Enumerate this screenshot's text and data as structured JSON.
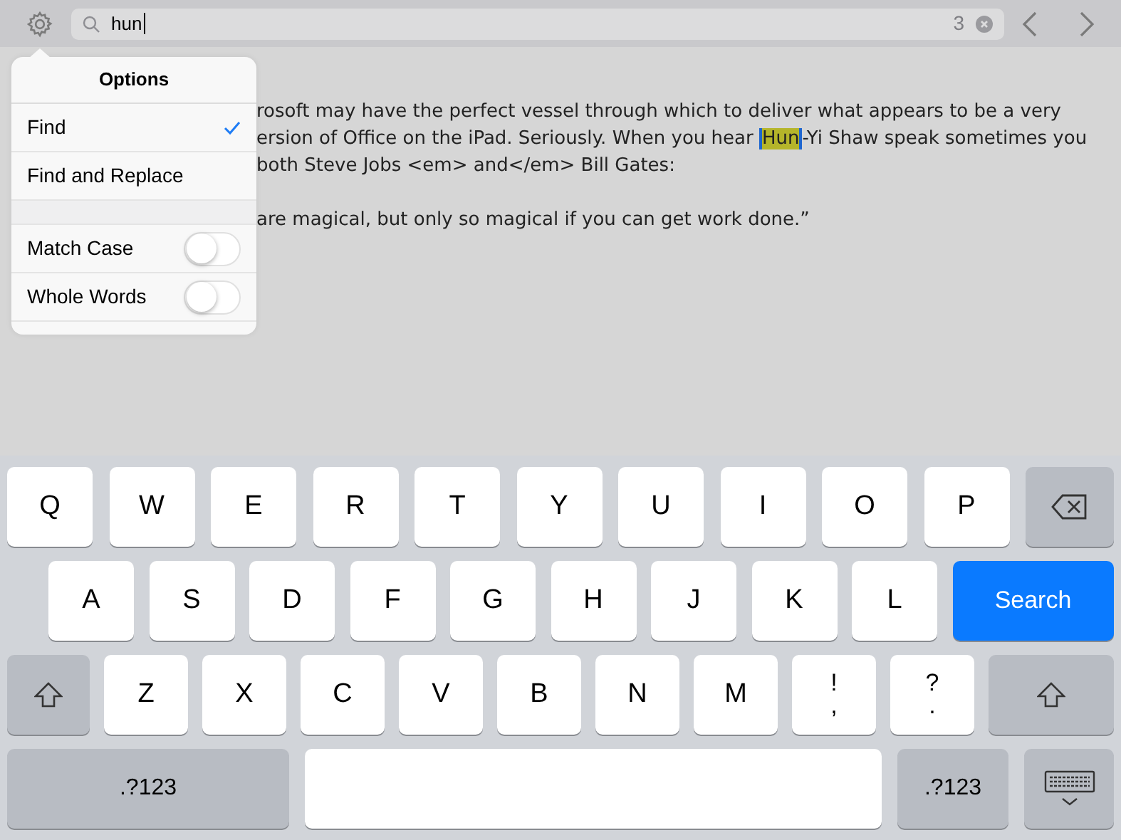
{
  "search": {
    "value": "hun",
    "count": "3"
  },
  "popover": {
    "title": "Options",
    "modes": [
      {
        "label": "Find",
        "selected": true
      },
      {
        "label": "Find and Replace",
        "selected": false
      }
    ],
    "toggles": [
      {
        "label": "Match Case",
        "on": false
      },
      {
        "label": "Whole Words",
        "on": false
      }
    ]
  },
  "document": {
    "paragraphs": [
      [
        {
          "text": "rosoft may have the perfect vessel through which to deliver what appears to be a very"
        },
        {
          "text": "ersion of Office on the iPad. Seriously. When you hear ",
          "match": "Hun",
          "after": "-Yi Shaw speak sometimes you"
        },
        {
          "text": "both Steve Jobs <em> and</em> Bill Gates:"
        }
      ],
      [
        {
          "text": "are magical, but only so magical if you can get work done.”"
        }
      ]
    ]
  },
  "keyboard": {
    "rows": [
      {
        "keys": [
          {
            "kind": "letter",
            "label": "Q"
          },
          {
            "kind": "letter",
            "label": "W"
          },
          {
            "kind": "letter",
            "label": "E"
          },
          {
            "kind": "letter",
            "label": "R"
          },
          {
            "kind": "letter",
            "label": "T"
          },
          {
            "kind": "letter",
            "label": "Y"
          },
          {
            "kind": "letter",
            "label": "U"
          },
          {
            "kind": "letter",
            "label": "I"
          },
          {
            "kind": "letter",
            "label": "O"
          },
          {
            "kind": "letter",
            "label": "P"
          },
          {
            "kind": "delete"
          }
        ]
      },
      {
        "keys": [
          {
            "kind": "letter",
            "label": "A"
          },
          {
            "kind": "letter",
            "label": "S"
          },
          {
            "kind": "letter",
            "label": "D"
          },
          {
            "kind": "letter",
            "label": "F"
          },
          {
            "kind": "letter",
            "label": "G"
          },
          {
            "kind": "letter",
            "label": "H"
          },
          {
            "kind": "letter",
            "label": "J"
          },
          {
            "kind": "letter",
            "label": "K"
          },
          {
            "kind": "letter",
            "label": "L"
          },
          {
            "kind": "search",
            "label": "Search"
          }
        ]
      },
      {
        "keys": [
          {
            "kind": "shift"
          },
          {
            "kind": "letter",
            "label": "Z"
          },
          {
            "kind": "letter",
            "label": "X"
          },
          {
            "kind": "letter",
            "label": "C"
          },
          {
            "kind": "letter",
            "label": "V"
          },
          {
            "kind": "letter",
            "label": "B"
          },
          {
            "kind": "letter",
            "label": "N"
          },
          {
            "kind": "letter",
            "label": "M"
          },
          {
            "kind": "punct",
            "label": "!",
            "sublabel": ","
          },
          {
            "kind": "punct",
            "label": "?",
            "sublabel": "."
          },
          {
            "kind": "shift"
          }
        ]
      },
      {
        "keys": [
          {
            "kind": "numbers",
            "label": ".?123"
          },
          {
            "kind": "space"
          },
          {
            "kind": "numbers2",
            "label": ".?123"
          },
          {
            "kind": "dismiss"
          }
        ]
      }
    ]
  }
}
